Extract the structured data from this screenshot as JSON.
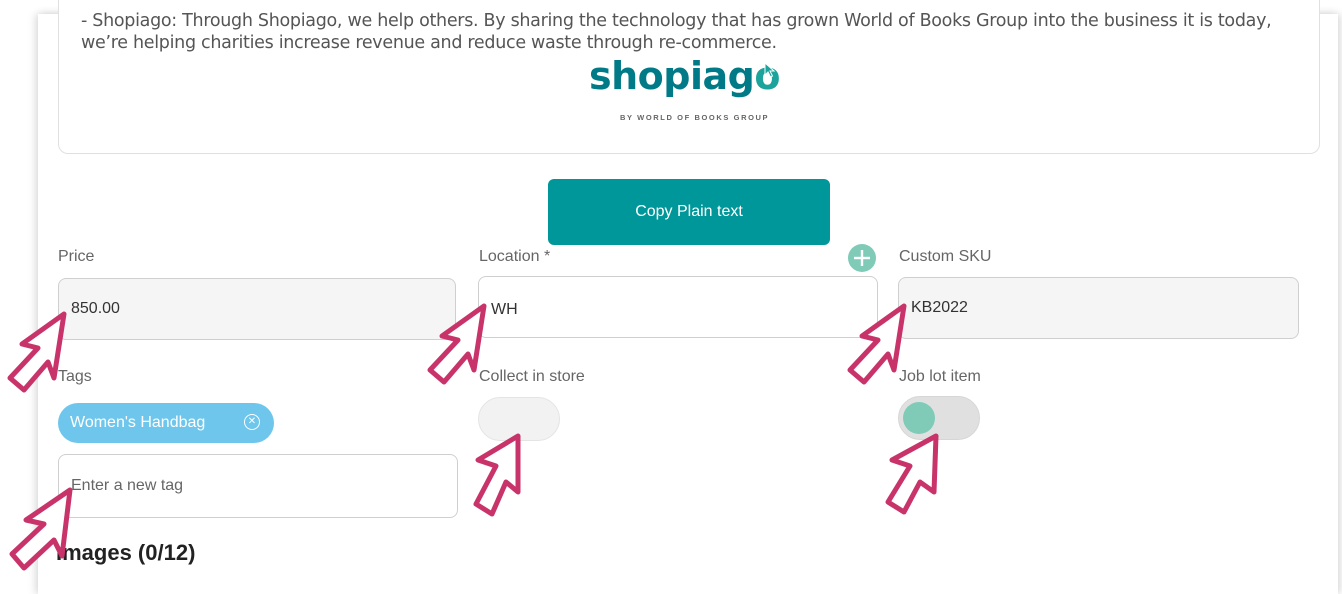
{
  "description": {
    "text": "- Shopiago: Through Shopiago, we help others. By sharing the technology that has grown World of Books Group into the business it is today, we’re helping charities increase revenue and reduce waste through re-commerce.",
    "logo": {
      "word_main": "shopiag",
      "word_accent": "o",
      "subtitle": "BY WORLD OF BOOKS GROUP"
    }
  },
  "copy_button": {
    "label": "Copy Plain text"
  },
  "fields": {
    "price": {
      "label": "Price",
      "value": "850.00"
    },
    "location": {
      "label": "Location *",
      "value": "WH"
    },
    "custom_sku": {
      "label": "Custom SKU",
      "value": "KB2022"
    }
  },
  "tags": {
    "label": "Tags",
    "chips": [
      {
        "label": "Women's Handbag"
      }
    ],
    "input_placeholder": "Enter a new tag"
  },
  "collect_in_store": {
    "label": "Collect in store",
    "enabled": false
  },
  "job_lot_item": {
    "label": "Job lot item",
    "enabled": false
  },
  "images": {
    "heading": "Images (0/12)"
  },
  "colors": {
    "brand_teal": "#00979a",
    "tag_blue": "#6ec6ec",
    "toggle_knob": "#7fcbb8",
    "annotation": "#c8336a"
  },
  "icons": [
    "plus-circle-icon",
    "close-circle-icon",
    "pointer-cursor-icon"
  ]
}
